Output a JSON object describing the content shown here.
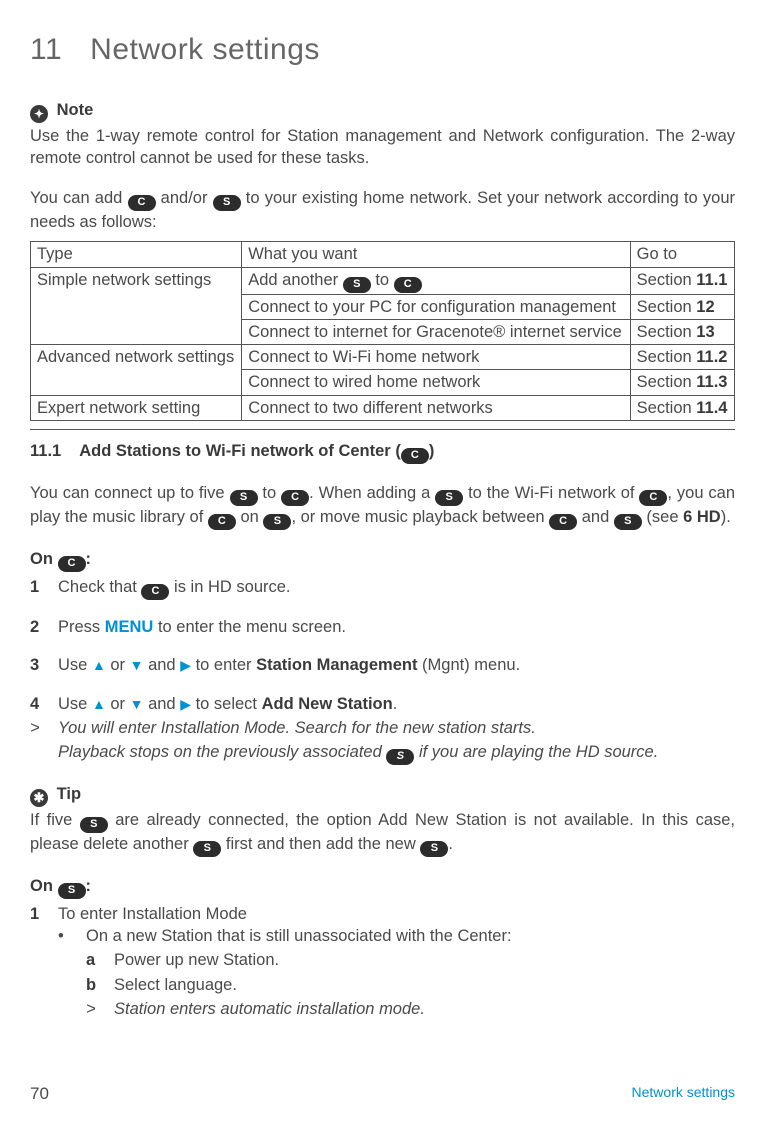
{
  "chapter": {
    "num": "11",
    "title": "Network settings"
  },
  "note": {
    "label": "Note",
    "text": "Use the 1-way remote control for Station management and Network configuration. The 2-way remote control cannot be used for these tasks."
  },
  "intro": {
    "pre": "You can add ",
    "badgeC": "C",
    "mid1": " and/or ",
    "badgeS": "S",
    "post": " to your existing home network. Set your network according to your needs as follows:"
  },
  "table": {
    "headers": {
      "type": "Type",
      "want": "What you want",
      "goto": "Go to"
    },
    "rows": [
      {
        "type": "Simple network settings",
        "want_pre": "Add another ",
        "want_badge1": "S",
        "want_mid": " to ",
        "want_badge2": "C",
        "want_post": "",
        "goto_pre": "Section ",
        "goto_b": "11.1",
        "rowspan": 3
      },
      {
        "want": "Connect to your PC for configuration management",
        "goto_pre": "Section ",
        "goto_b": "12"
      },
      {
        "want": "Connect to internet for Gracenote® internet service",
        "goto_pre": "Section ",
        "goto_b": "13"
      },
      {
        "type": "Advanced network settings",
        "want": "Connect to Wi-Fi home network",
        "goto_pre": "Section ",
        "goto_b": "11.2",
        "rowspan": 2
      },
      {
        "want": "Connect to wired home network",
        "goto_pre": "Section ",
        "goto_b": "11.3"
      },
      {
        "type": "Expert network setting",
        "want": "Connect to two different networks",
        "goto_pre": "Section ",
        "goto_b": "11.4"
      }
    ]
  },
  "section": {
    "num": "11.1",
    "title_pre": "Add Stations to Wi-Fi network of Center (",
    "title_badge": "C",
    "title_post": ")"
  },
  "para1": {
    "t1": "You can connect up to five ",
    "b1": "S",
    "t2": " to ",
    "b2": "C",
    "t3": ". When adding a ",
    "b3": "S",
    "t4": " to the Wi-Fi network of ",
    "b4": "C",
    "t5": ", you can play the music library of ",
    "b5": "C",
    "t6": " on ",
    "b6": "S",
    "t7": ", or move music playback between ",
    "b7": "C",
    "t8": " and ",
    "b8": "S",
    "t9": " (see ",
    "t9b": "6 HD",
    "t10": ")."
  },
  "onC": {
    "pre": "On ",
    "badge": "C",
    "post": ":"
  },
  "steps": {
    "s1": {
      "n": "1",
      "t1": "Check that ",
      "b": "C",
      "t2": " is in HD source."
    },
    "s2": {
      "n": "2",
      "t1": "Press ",
      "menu": "MENU",
      "t2": " to enter the menu screen."
    },
    "s3": {
      "n": "3",
      "t1": "Use ",
      "up": "▲",
      "or": " or ",
      "dn": "▼",
      "and": " and ",
      "rt": "▶",
      "t2": " to enter ",
      "b": "Station Management",
      "t3": " (Mgnt) menu."
    },
    "s4": {
      "n": "4",
      "t1": "Use ",
      "up": "▲",
      "or": " or ",
      "dn": "▼",
      "and": " and ",
      "rt": "▶",
      "t2": " to select ",
      "b": "Add New Station",
      "t3": "."
    },
    "r4a": {
      "m": ">",
      "t": "You will enter Installation Mode. Search for the new station starts."
    },
    "r4b": {
      "t1": "Playback stops on the previously associated ",
      "b": "S",
      "t2": " if you are playing the HD source."
    }
  },
  "tip": {
    "label": "Tip",
    "t1": "If five ",
    "b1": "S",
    "t2": " are already connected, the option Add New Station is not available. In this case, please delete another ",
    "b2": "S",
    "t3": " first and then add the new ",
    "b3": "S",
    "t4": "."
  },
  "onS": {
    "pre": "On ",
    "badge": "S",
    "post": ":"
  },
  "steps2": {
    "s1": {
      "n": "1",
      "t": "To enter Installation Mode"
    },
    "bullet": {
      "m": "•",
      "t": "On a new Station that is still unassociated with the Center:"
    },
    "a": {
      "m": "a",
      "t": "Power up new Station."
    },
    "b": {
      "m": "b",
      "t": "Select language."
    },
    "r": {
      "m": ">",
      "t": "Station enters automatic installation mode."
    }
  },
  "footer": {
    "page": "70",
    "label": "Network settings"
  }
}
